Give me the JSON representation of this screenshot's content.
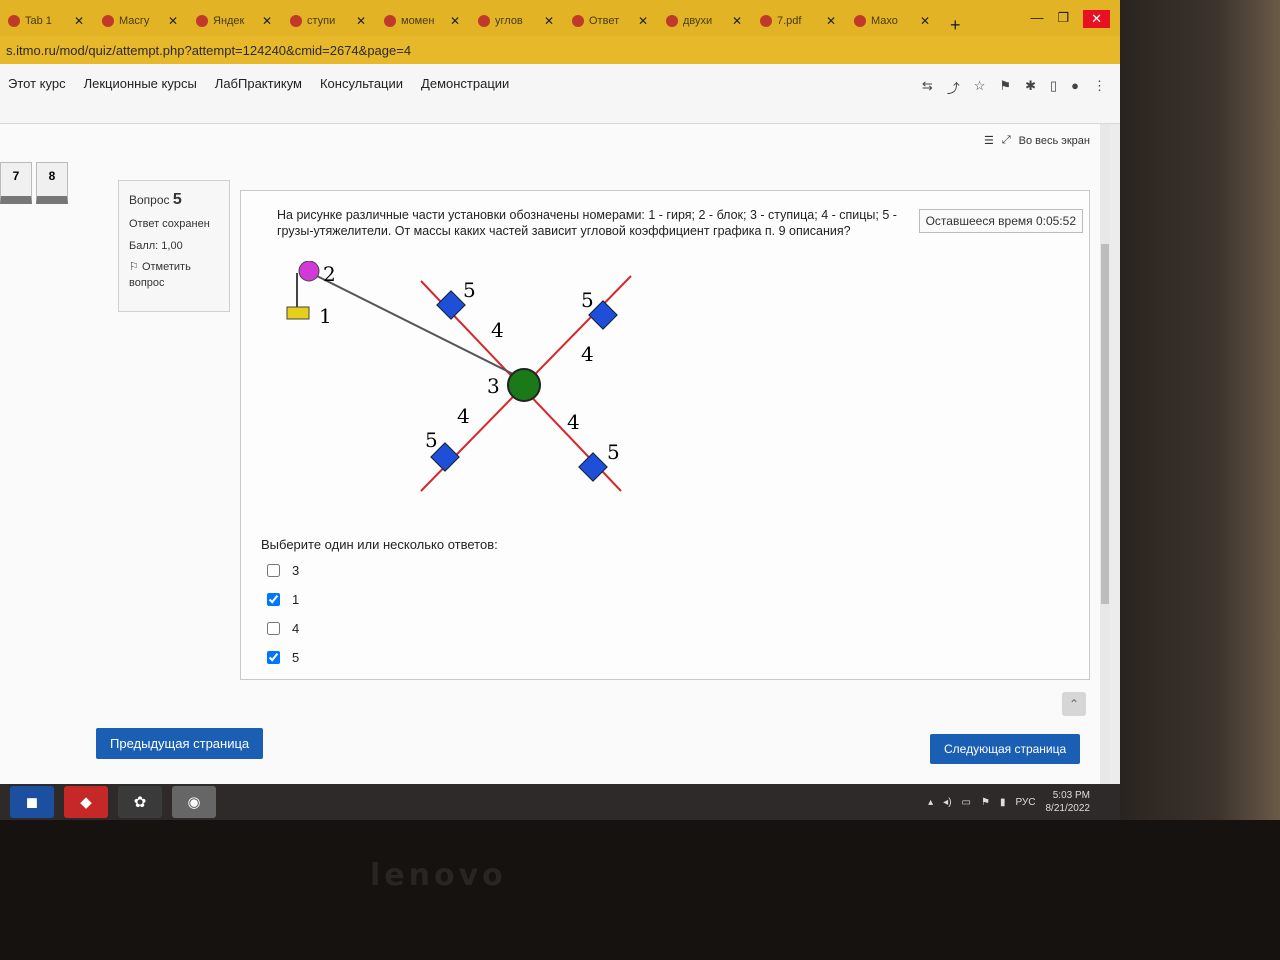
{
  "tabs": [
    {
      "label": "Tab 1"
    },
    {
      "label": "Масгу"
    },
    {
      "label": "Яндек"
    },
    {
      "label": "ступи"
    },
    {
      "label": "момен"
    },
    {
      "label": "углов"
    },
    {
      "label": "Ответ"
    },
    {
      "label": "двухи"
    },
    {
      "label": "7.pdf"
    },
    {
      "label": "Махо"
    }
  ],
  "address": {
    "url": "s.itmo.ru/mod/quiz/attempt.php?attempt=124240&cmid=2674&page=4"
  },
  "nav": {
    "links": [
      "Этот курс",
      "Лекционные курсы",
      "ЛабПрактикум",
      "Консультации",
      "Демонстрации"
    ],
    "fullscreen_label": "Во весь экран"
  },
  "quiz_nav": {
    "buttons": [
      "7",
      "8"
    ]
  },
  "question_info": {
    "label": "Вопрос",
    "number": "5",
    "status": "Ответ сохранен",
    "score": "Балл: 1,00",
    "flag": "Отметить вопрос"
  },
  "timer": "Оставшееся время 0:05:52",
  "question": {
    "text": "На рисунке различные части установки обозначены номерами: 1 - гиря; 2 - блок; 3 - ступица; 4 - спицы; 5 - грузы-утяжелители. От массы каких частей зависит угловой коэффициент графика п. 9 описания?",
    "diagram_labels": {
      "weight": "1",
      "pulley": "2",
      "hub": "3",
      "spoke": "4",
      "load": "5"
    },
    "prompt": "Выберите один или несколько ответов:",
    "options": [
      {
        "label": "3",
        "checked": false
      },
      {
        "label": "1",
        "checked": true
      },
      {
        "label": "4",
        "checked": false
      },
      {
        "label": "5",
        "checked": true
      }
    ]
  },
  "buttons": {
    "prev": "Предыдущая страница",
    "next": "Следующая страница"
  },
  "taskbar": {
    "time": "5:03 PM",
    "date": "8/21/2022",
    "lang": "РУС"
  },
  "laptop_brand": "lenovo",
  "colors": {
    "tab_strip": "#e2b325",
    "button": "#1a5fb4",
    "spoke": "#d62828",
    "hub": "#1a7a1a",
    "load": "#1f4fd8",
    "pulley": "#d13ad6",
    "weight": "#e6cf1a"
  }
}
